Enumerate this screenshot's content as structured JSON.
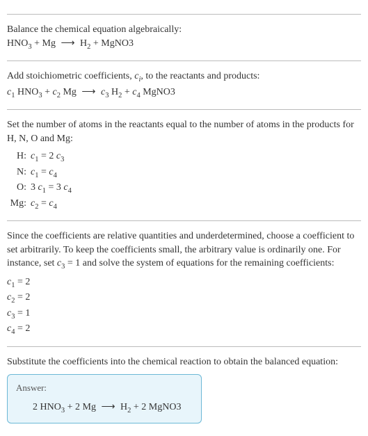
{
  "section1": {
    "title": "Balance the chemical equation algebraically:",
    "eqn_lhs1": "HNO",
    "eqn_sub1": "3",
    "eqn_plus1": " + Mg ",
    "arrow": "⟶",
    "eqn_rhs1": " H",
    "eqn_sub2": "2",
    "eqn_plus2": " + MgNO3"
  },
  "section2": {
    "title_a": "Add stoichiometric coefficients, ",
    "title_ci": "c",
    "title_ci_sub": "i",
    "title_b": ", to the reactants and products:",
    "c1": "c",
    "s1": "1",
    "t1": " HNO",
    "sub3": "3",
    "plus1": " + ",
    "c2": "c",
    "s2": "2",
    "t2": " Mg ",
    "arrow": "⟶",
    "sp": " ",
    "c3": "c",
    "s3": "3",
    "t3": " H",
    "sub2": "2",
    "plus2": " + ",
    "c4": "c",
    "s4": "4",
    "t4": " MgNO3"
  },
  "section3": {
    "title": "Set the number of atoms in the reactants equal to the number of atoms in the products for H, N, O and Mg:",
    "rows": [
      {
        "label": "H:",
        "lhs_c": "c",
        "lhs_s": "1",
        "eq": " = 2 ",
        "rhs_c": "c",
        "rhs_s": "3"
      },
      {
        "label": "N:",
        "lhs_c": "c",
        "lhs_s": "1",
        "eq": " = ",
        "rhs_c": "c",
        "rhs_s": "4"
      },
      {
        "label": "O:",
        "lhs_pre": "3 ",
        "lhs_c": "c",
        "lhs_s": "1",
        "eq": " = 3 ",
        "rhs_c": "c",
        "rhs_s": "4"
      },
      {
        "label": "Mg:",
        "lhs_c": "c",
        "lhs_s": "2",
        "eq": " = ",
        "rhs_c": "c",
        "rhs_s": "4"
      }
    ]
  },
  "section4": {
    "text_a": "Since the coefficients are relative quantities and underdetermined, choose a coefficient to set arbitrarily. To keep the coefficients small, the arbitrary value is ordinarily one. For instance, set ",
    "c3": "c",
    "s3": "3",
    "text_b": " = 1 and solve the system of equations for the remaining coefficients:",
    "coeffs": [
      {
        "c": "c",
        "s": "1",
        "val": " = 2"
      },
      {
        "c": "c",
        "s": "2",
        "val": " = 2"
      },
      {
        "c": "c",
        "s": "3",
        "val": " = 1"
      },
      {
        "c": "c",
        "s": "4",
        "val": " = 2"
      }
    ]
  },
  "section5": {
    "title": "Substitute the coefficients into the chemical reaction to obtain the balanced equation:",
    "answer_label": "Answer:",
    "ans_a": "2 HNO",
    "ans_sub3": "3",
    "ans_b": " + 2 Mg ",
    "arrow": "⟶",
    "ans_c": " H",
    "ans_sub2": "2",
    "ans_d": " + 2 MgNO3"
  }
}
